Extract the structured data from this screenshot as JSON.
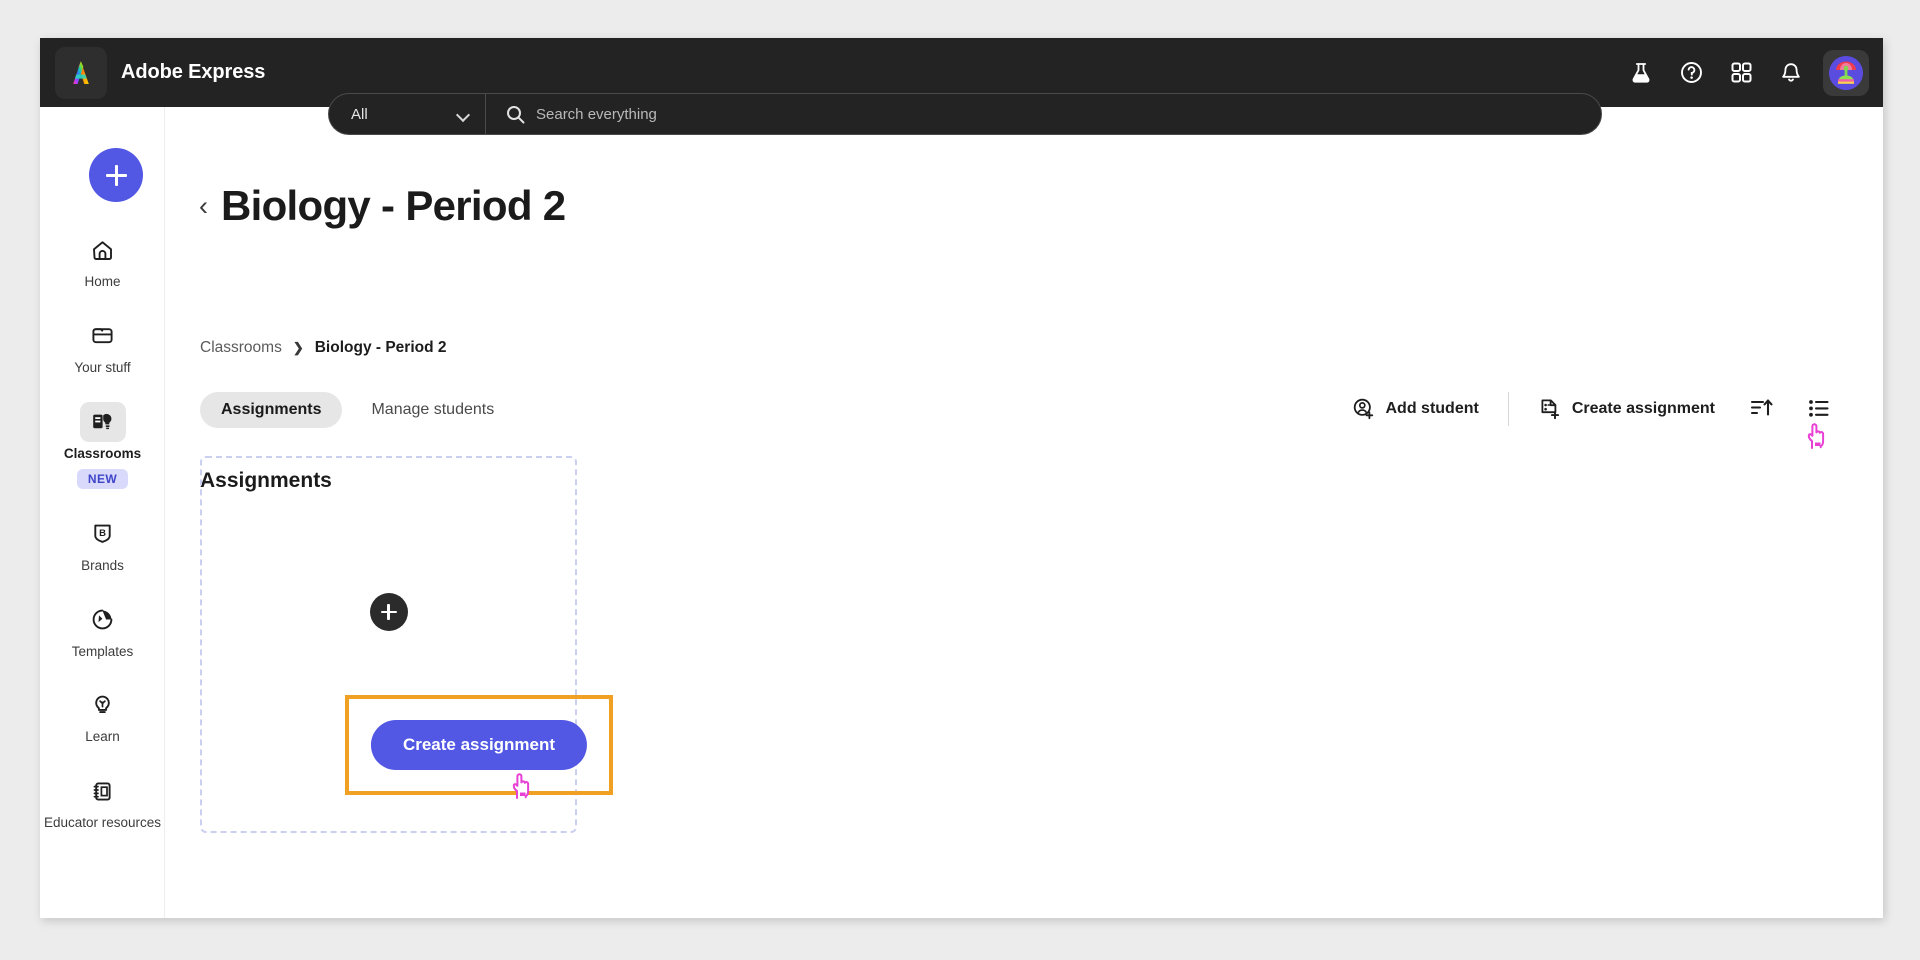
{
  "topbar": {
    "logo_icon": "adobe-express-logo-icon",
    "brand": "Adobe Express",
    "scope_value": "All",
    "scope_chevron_icon": "chevron-down-icon",
    "search_icon": "search-icon",
    "search_value": "",
    "search_placeholder": "Search everything",
    "icons": [
      {
        "name": "beaker-icon",
        "label": "Experiments"
      },
      {
        "name": "help-circle-icon",
        "label": "Help"
      },
      {
        "name": "apps-grid-icon",
        "label": "Apps"
      },
      {
        "name": "bell-icon",
        "label": "Notifications"
      }
    ],
    "avatar": {
      "name": "avatar",
      "label": "Account"
    }
  },
  "rail": {
    "create_button": {
      "icon": "plus-icon",
      "label": "Create new"
    },
    "items": [
      {
        "label": "Home",
        "icon": "home-icon",
        "active": false,
        "badge": ""
      },
      {
        "label": "Your stuff",
        "icon": "folder-icon",
        "active": false,
        "badge": ""
      },
      {
        "label": "Classrooms",
        "icon": "classrooms-icon",
        "active": true,
        "badge": "NEW"
      },
      {
        "label": "Brands",
        "icon": "brand-shield-icon",
        "active": false,
        "badge": ""
      },
      {
        "label": "Templates",
        "icon": "templates-icon",
        "active": false,
        "badge": ""
      },
      {
        "label": "Learn",
        "icon": "lightbulb-icon",
        "active": false,
        "badge": ""
      },
      {
        "label": "Educator resources",
        "icon": "notebook-icon",
        "active": false,
        "badge": ""
      }
    ]
  },
  "page": {
    "back_icon": "chevron-left-icon",
    "title": "Biology - Period 2",
    "breadcrumb": {
      "root": "Classrooms",
      "separator": "›",
      "current": "Biology - Period 2"
    },
    "tabs": [
      {
        "label": "Assignments",
        "active": true
      },
      {
        "label": "Manage students",
        "active": false
      }
    ],
    "toolbar": {
      "add_student": {
        "label": "Add student",
        "icon": "add-person-icon"
      },
      "create_assignment": {
        "label": "Create assignment",
        "icon": "add-document-icon"
      },
      "sort": {
        "label": "Sort",
        "icon": "sort-ascending-icon"
      },
      "view": {
        "label": "List view",
        "icon": "list-view-icon"
      }
    },
    "section_heading": "Assignments",
    "dropzone": {
      "plus_icon": "plus-circle-icon",
      "cta_label": "Create assignment"
    }
  },
  "annotations": {
    "highlight_color": "#f0a022",
    "cursor_color": "#e83fd4",
    "accent_blue": "#5258e4",
    "badge_bg": "#d8d9fb",
    "badge_text": "#3f45c7"
  }
}
